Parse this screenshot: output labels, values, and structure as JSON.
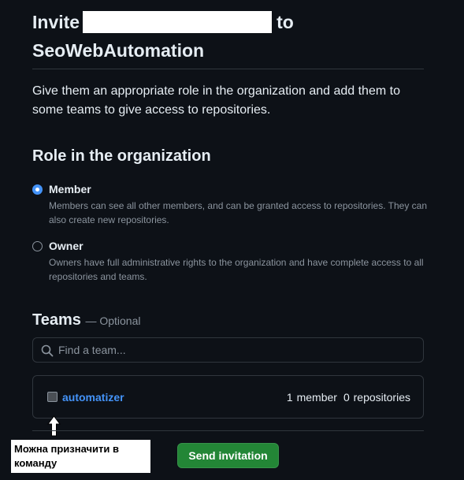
{
  "header": {
    "prefix": "Invite",
    "suffix": "to",
    "organization": "SeoWebAutomation"
  },
  "intro": "Give them an appropriate role in the organization and add them to some teams to give access to repositories.",
  "role_section": {
    "title": "Role in the organization",
    "options": [
      {
        "label": "Member",
        "description": "Members can see all other members, and can be granted access to repositories. They can also create new repositories.",
        "checked": true
      },
      {
        "label": "Owner",
        "description": "Owners have full administrative rights to the organization and have complete access to all repositories and teams.",
        "checked": false
      }
    ]
  },
  "teams_section": {
    "title": "Teams",
    "optional": "— Optional",
    "search_placeholder": "Find a team...",
    "teams": [
      {
        "name": "automatizer",
        "members": "1 member",
        "repositories": "0 repositories",
        "checked": false
      }
    ]
  },
  "annotation": "Можна призначити в команду",
  "send_button": "Send invitation",
  "colors": {
    "background": "#0d1117",
    "text": "#e6edf3",
    "muted": "#8b949e",
    "border": "#30363d",
    "link": "#4493f8",
    "button": "#238636"
  },
  "icons": [
    "search-icon",
    "arrow-up-icon"
  ]
}
